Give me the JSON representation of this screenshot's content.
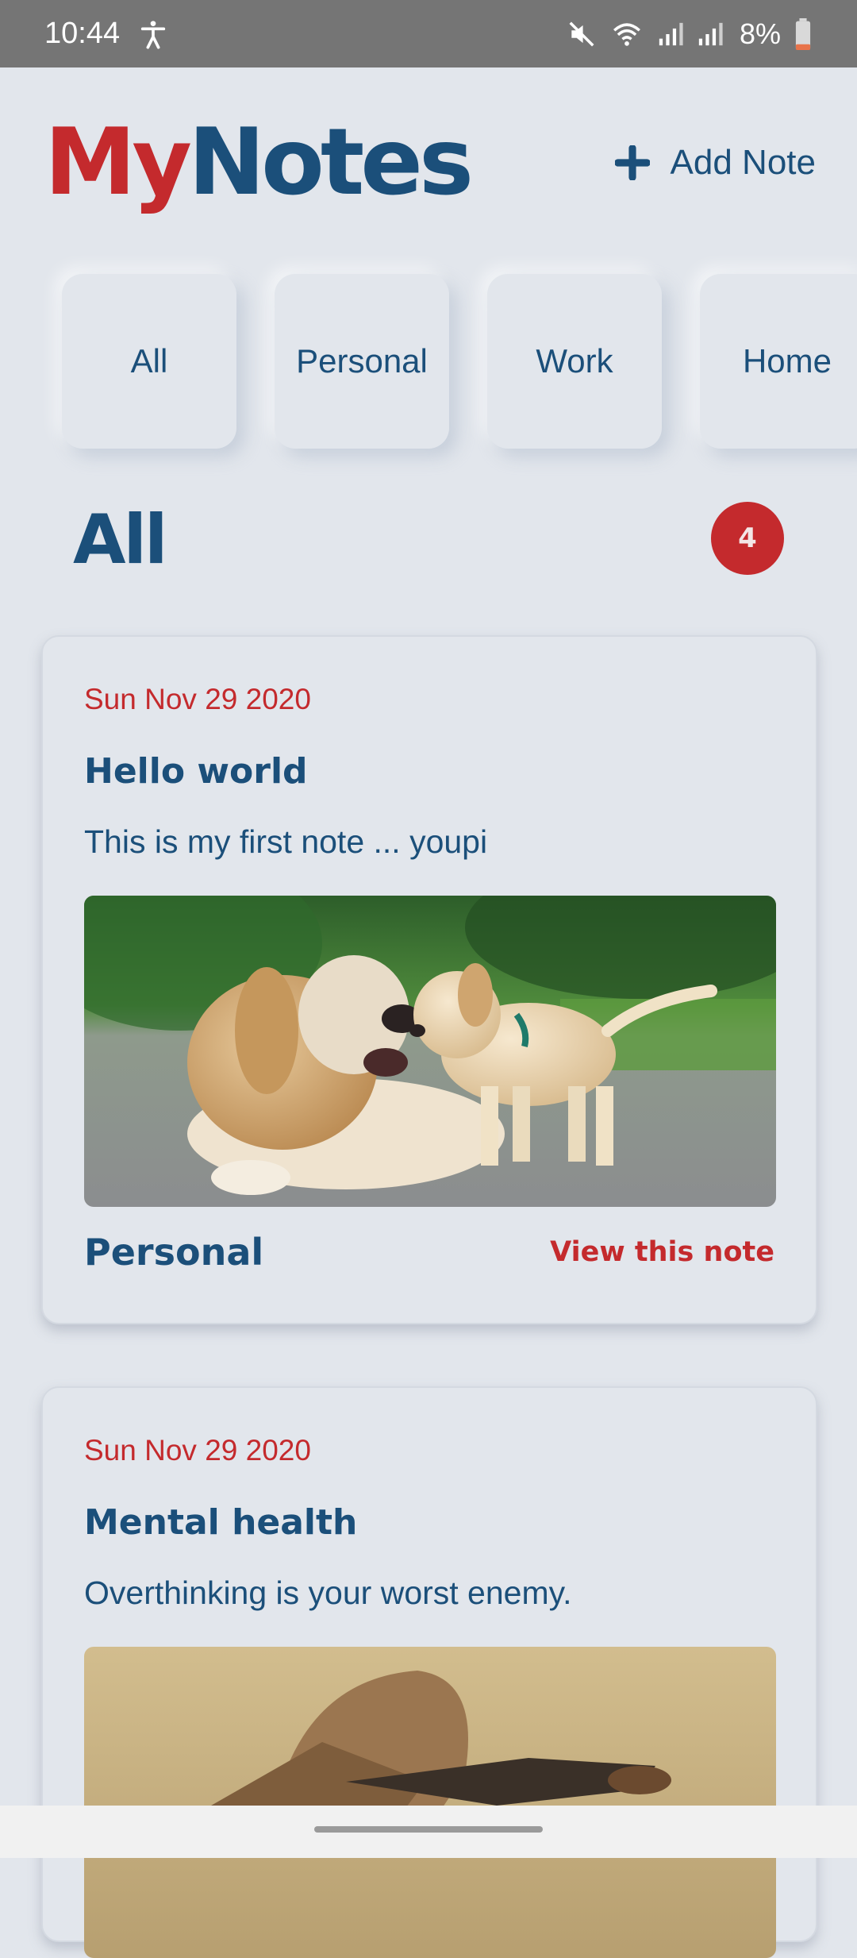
{
  "status_bar": {
    "time": "10:44",
    "battery": "8%",
    "icons": [
      "accessibility-icon",
      "mute-icon",
      "wifi-icon",
      "signal-icon",
      "signal-icon",
      "battery-icon"
    ]
  },
  "header": {
    "logo_part1": "My",
    "logo_part2": "Notes",
    "add_note_label": "Add Note",
    "add_note_icon": "plus-icon"
  },
  "categories": [
    "All",
    "Personal",
    "Work",
    "Home"
  ],
  "section": {
    "title": "All",
    "count": "4"
  },
  "notes": [
    {
      "date": "Sun Nov 29 2020",
      "title": "Hello world",
      "body": "This is my first note ... youpi",
      "image": "old dog and puppy on a road",
      "category": "Personal",
      "action": "View this note"
    },
    {
      "date": "Sun Nov 29 2020",
      "title": "Mental health",
      "body": "Overthinking is your worst enemy.",
      "image": "person with head buried in sand"
    }
  ],
  "colors": {
    "background": "#e2e6ec",
    "primary_blue": "#1b4f7a",
    "accent_red": "#c42a2d"
  }
}
